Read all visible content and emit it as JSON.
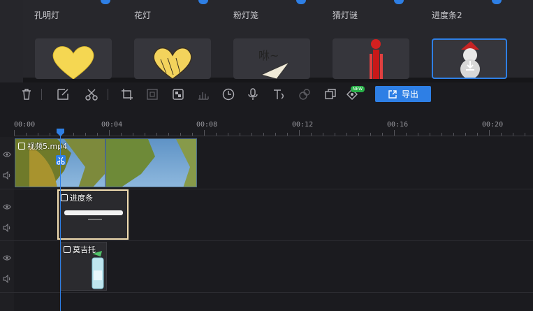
{
  "sticker_panel": {
    "items": [
      {
        "label": "孔明灯",
        "icon": "sky-lantern"
      },
      {
        "label": "花灯",
        "icon": "flower-lantern"
      },
      {
        "label": "粉灯笼",
        "icon": "pink-lantern"
      },
      {
        "label": "猜灯谜",
        "icon": "lantern-riddle"
      },
      {
        "label": "进度条2",
        "icon": "progress-bar-2"
      }
    ],
    "tiles": [
      {
        "icon": "yellow-heart-sticker"
      },
      {
        "icon": "yellow-heart-doodle-sticker"
      },
      {
        "icon": "paper-plane-sticker",
        "text": "咻~"
      },
      {
        "icon": "red-firecracker-sticker"
      },
      {
        "icon": "santa-snowman-sticker",
        "selected": true
      }
    ]
  },
  "toolbar": {
    "tools": [
      "delete-icon",
      "crop-edit-icon",
      "scissors-icon",
      "crop-icon",
      "resize-icon",
      "mosaic-icon",
      "audio-bars-icon",
      "clock-icon",
      "microphone-icon",
      "text-to-speech-icon",
      "color-pick-icon",
      "duplicate-icon",
      "ai-tag-icon"
    ],
    "new_badge": "NEW",
    "export_label": "导出"
  },
  "ruler": {
    "labels": [
      "00:00",
      "00:04",
      "00:08",
      "00:12",
      "00:16",
      "00:20"
    ]
  },
  "tracks": {
    "video_clip": {
      "name": "视频5.mp4"
    },
    "progress_clip": {
      "name": "进度条"
    },
    "mozhito_clip": {
      "name": "莫吉托"
    }
  },
  "colors": {
    "accent": "#2e7fe5",
    "selection": "#f1ddb2",
    "new_badge": "#27b047"
  }
}
